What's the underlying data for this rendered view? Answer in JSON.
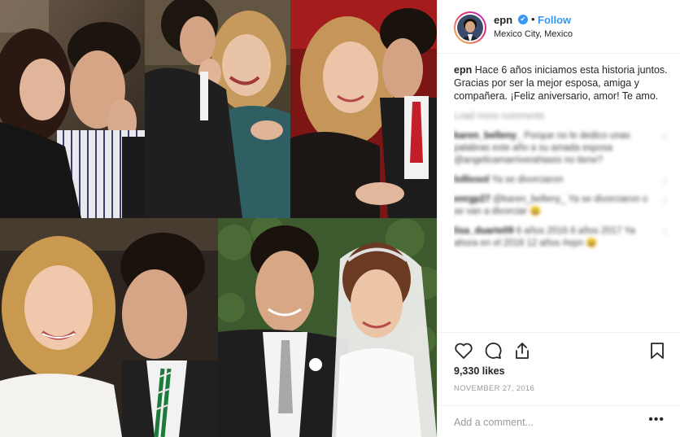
{
  "post": {
    "photo_description_icon": "photo-collage",
    "username": "epn",
    "verified_icon": "verified-badge-icon",
    "separator": "•",
    "follow_label": "Follow",
    "location": "Mexico City, Mexico",
    "caption": {
      "username": "epn",
      "text": "Hace 6 años iniciamos esta historia juntos. Gracias por ser la mejor esposa, amiga y compañera. ¡Feliz aniversario, amor! Te amo."
    },
    "load_more": "Load more comments",
    "comments": [
      {
        "user": "karen_belleny_",
        "text": "Porque no le dedico unas palabras este año a su amada esposa @angelicamarriverahiasis no tiene?"
      },
      {
        "user": "lolliosol",
        "text": "Ya se divorciaron"
      },
      {
        "user": "enrgp27",
        "text": "@karen_belleny_ Ya se divorciaron o se van a divorciar 😄"
      },
      {
        "user": "lisa_duarte09",
        "text": "6 años  2016 6 años 2017 Ya ahora en el 2018 12 años #epn 😄"
      }
    ],
    "likes": "9,330 likes",
    "date": "NOVEMBER 27, 2016",
    "add_comment_placeholder": "Add a comment...",
    "more_label": "•••",
    "icons": [
      "heart-icon",
      "comment-icon",
      "share-icon",
      "bookmark-icon"
    ],
    "colors": {
      "link": "#3897f0",
      "muted": "#999999",
      "border": "#efefef"
    }
  }
}
